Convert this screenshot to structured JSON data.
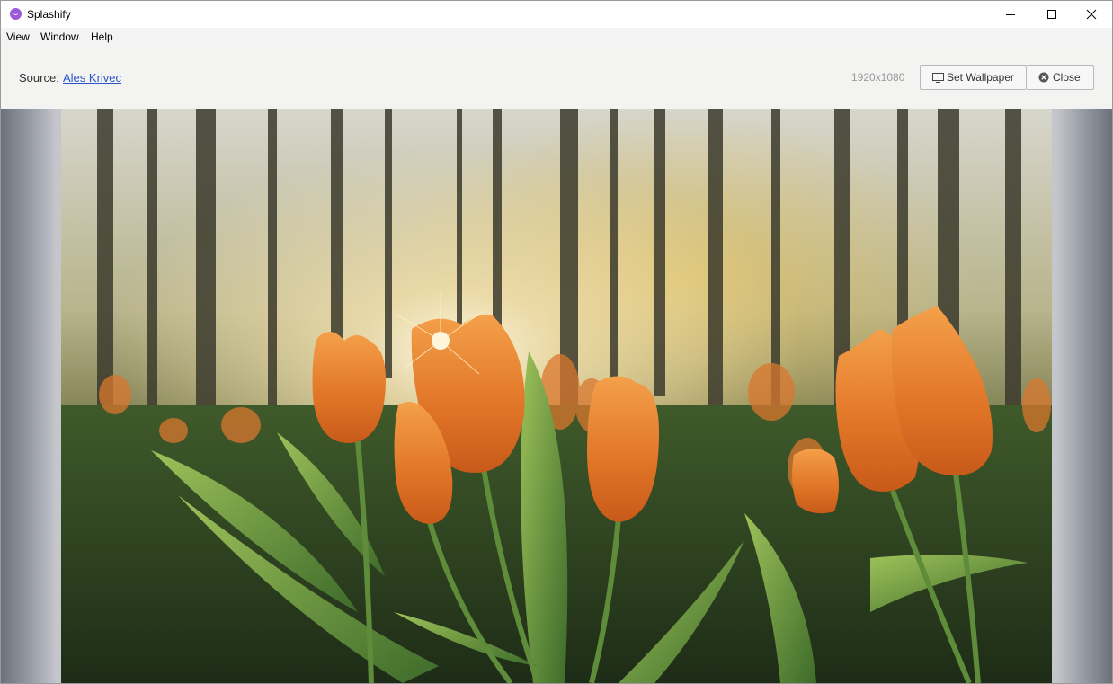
{
  "window": {
    "title": "Splashify",
    "app_icon": "splashify-smiley-icon",
    "controls": {
      "minimize": "minimize-icon",
      "maximize": "maximize-icon",
      "close": "close-icon"
    }
  },
  "menu": {
    "items": [
      "View",
      "Window",
      "Help"
    ]
  },
  "toolbar": {
    "source_label": "Source:",
    "source_author": "Ales Krivec",
    "resolution": "1920x1080",
    "set_wallpaper_label": "Set Wallpaper",
    "set_wallpaper_icon": "monitor-icon",
    "close_label": "Close",
    "close_icon": "circle-x-icon"
  },
  "colors": {
    "app_accent": "#9b59d6",
    "link": "#2a55c8",
    "toolbar_bg": "#f3f3f2"
  }
}
